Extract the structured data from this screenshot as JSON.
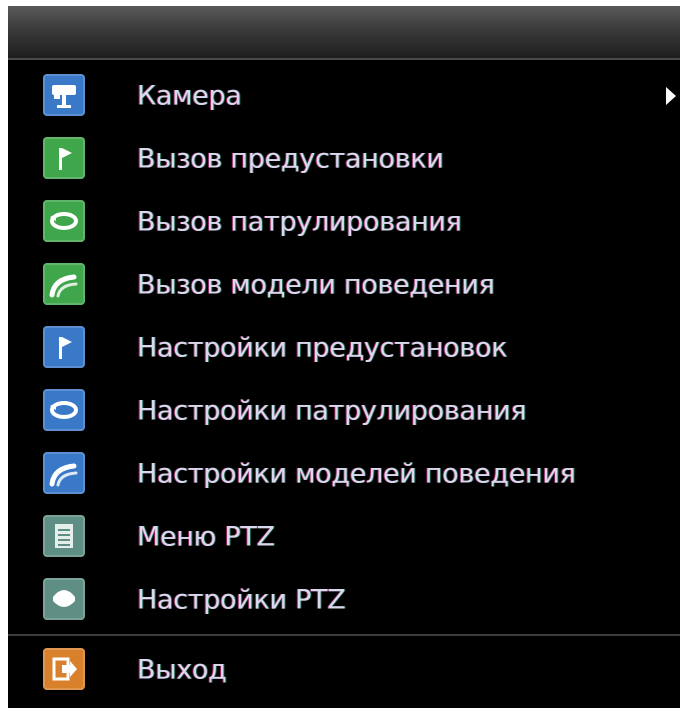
{
  "menu": {
    "items": [
      {
        "label": "Камера",
        "icon": "camera-icon",
        "color": "#3a78c8",
        "has_submenu": true
      },
      {
        "label": "Вызов предустановки",
        "icon": "preset-flag-icon",
        "color": "#3fa64c"
      },
      {
        "label": "Вызов патрулирования",
        "icon": "patrol-loop-icon",
        "color": "#3fa64c"
      },
      {
        "label": "Вызов модели поведения",
        "icon": "pattern-curve-icon",
        "color": "#3fa64c"
      },
      {
        "label": "Настройки предустановок",
        "icon": "preset-flag-icon",
        "color": "#3a78c8"
      },
      {
        "label": "Настройки патрулирования",
        "icon": "patrol-loop-icon",
        "color": "#3a78c8"
      },
      {
        "label": "Настройки моделей поведения",
        "icon": "pattern-curve-icon",
        "color": "#3a78c8"
      },
      {
        "label": "Меню PTZ",
        "icon": "menu-list-icon",
        "color": "#5f8f84"
      },
      {
        "label": "Настройки PTZ",
        "icon": "ptz-dome-icon",
        "color": "#5f8f84"
      }
    ],
    "exit": {
      "label": "Выход",
      "icon": "exit-icon",
      "color": "#d8802c"
    }
  }
}
